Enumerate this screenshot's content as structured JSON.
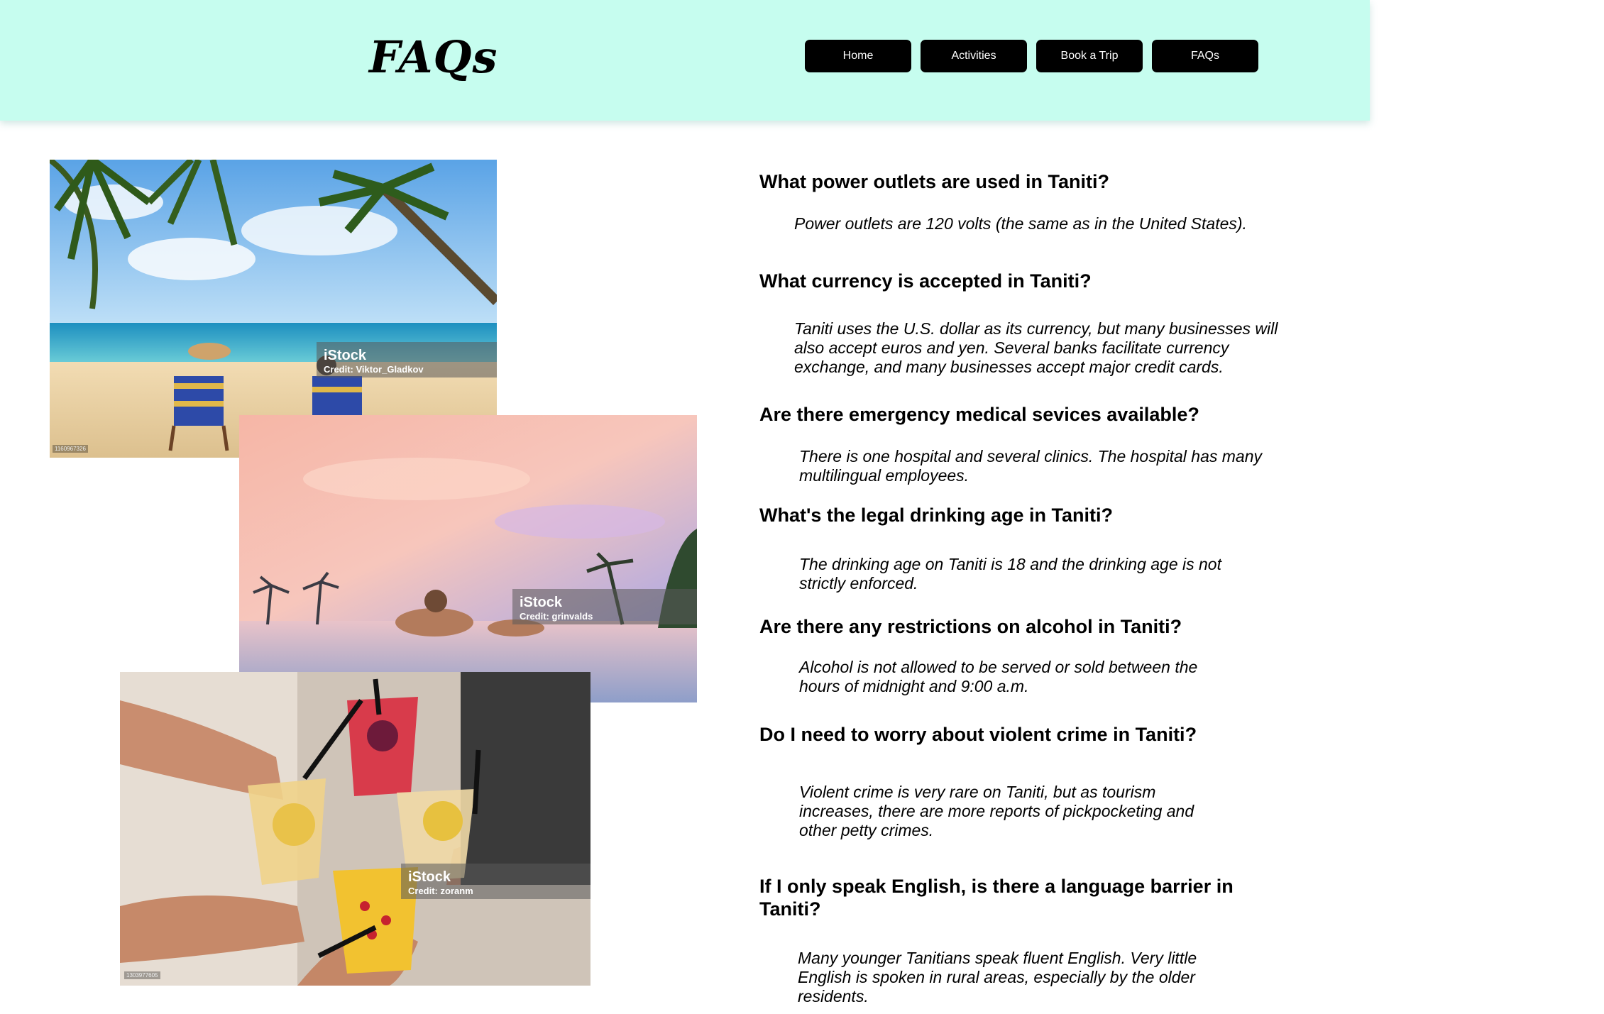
{
  "header": {
    "title": "FAQs",
    "background_color": "#c6fdef",
    "nav": [
      {
        "label": "Home"
      },
      {
        "label": "Activities"
      },
      {
        "label": "Book a Trip"
      },
      {
        "label": "FAQs"
      }
    ]
  },
  "photos": [
    {
      "name": "beach-chairs-photo",
      "brand": "iStock",
      "credit": "Credit: Viktor_Gladkov",
      "id": "1160967326"
    },
    {
      "name": "infinity-pool-photo",
      "brand": "iStock",
      "credit": "Credit: grinvalds"
    },
    {
      "name": "cocktails-toast-photo",
      "brand": "iStock",
      "credit": "Credit: zoranm",
      "id": "1303977605"
    }
  ],
  "faqs": [
    {
      "question": "What power outlets are used in Taniti?",
      "answer": "Power outlets are 120 volts (the same as in the United States)."
    },
    {
      "question": "What currency is accepted in Taniti?",
      "answer": "Taniti uses the U.S. dollar as its currency, but many businesses will also accept euros and yen. Several banks facilitate currency exchange, and many businesses accept major credit cards."
    },
    {
      "question": "Are there emergency medical sevices available?",
      "answer": "There is one hospital and several clinics. The hospital has many multilingual employees."
    },
    {
      "question": "What's the legal drinking age in Taniti?",
      "answer": "The drinking age on Taniti is 18 and the drinking age is not strictly enforced."
    },
    {
      "question": "Are there any restrictions on alcohol in Taniti?",
      "answer": "Alcohol is not allowed to be served or sold between the hours of midnight and 9:00 a.m."
    },
    {
      "question": "Do I need to worry about violent crime in Taniti?",
      "answer": "Violent crime is very rare on Taniti, but as tourism increases, there are more reports of pickpocketing and other petty crimes."
    },
    {
      "question": "If I only speak English, is there a language barrier in Taniti?",
      "answer": "Many younger Tanitians speak fluent English. Very little English is spoken in rural areas, especially by the older residents."
    }
  ]
}
